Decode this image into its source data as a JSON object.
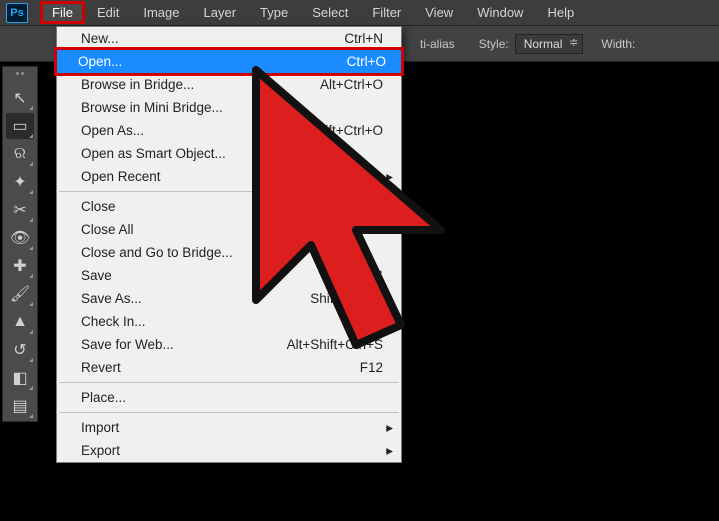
{
  "app": {
    "logo_text": "Ps"
  },
  "menubar": {
    "items": [
      "File",
      "Edit",
      "Image",
      "Layer",
      "Type",
      "Select",
      "Filter",
      "View",
      "Window",
      "Help"
    ]
  },
  "optionbar": {
    "antialias_label": "ti-alias",
    "style_label": "Style:",
    "style_value": "Normal",
    "width_label": "Width:"
  },
  "toolbox": {
    "tools": [
      {
        "name": "move-tool",
        "glyph": "↖"
      },
      {
        "name": "rect-marquee-tool",
        "glyph": "▭",
        "active": true
      },
      {
        "name": "lasso-tool",
        "glyph": "ର"
      },
      {
        "name": "magic-wand-tool",
        "glyph": "✦"
      },
      {
        "name": "crop-tool",
        "glyph": "✂"
      },
      {
        "name": "eyedropper-tool",
        "glyph": "👁"
      },
      {
        "name": "healing-brush-tool",
        "glyph": "✚"
      },
      {
        "name": "brush-tool",
        "glyph": "🖌"
      },
      {
        "name": "clone-stamp-tool",
        "glyph": "▲"
      },
      {
        "name": "history-brush-tool",
        "glyph": "↺"
      },
      {
        "name": "eraser-tool",
        "glyph": "◧"
      },
      {
        "name": "gradient-tool",
        "glyph": "▤"
      }
    ]
  },
  "file_menu": {
    "items": [
      {
        "label": "New...",
        "shortcut": "Ctrl+N"
      },
      {
        "label": "Open...",
        "shortcut": "Ctrl+O",
        "highlighted": true
      },
      {
        "label": "Browse in Bridge...",
        "shortcut": "Alt+Ctrl+O"
      },
      {
        "label": "Browse in Mini Bridge..."
      },
      {
        "label": "Open As...",
        "shortcut": "Alt+Shift+Ctrl+O"
      },
      {
        "label": "Open as Smart Object..."
      },
      {
        "label": "Open Recent",
        "submenu": true
      },
      {
        "sep": true
      },
      {
        "label": "Close"
      },
      {
        "label": "Close All"
      },
      {
        "label": "Close and Go to Bridge..."
      },
      {
        "label": "Save",
        "shortcut": "Ctrl+S"
      },
      {
        "label": "Save As...",
        "shortcut": "Shift+Ctrl+S"
      },
      {
        "label": "Check In..."
      },
      {
        "label": "Save for Web...",
        "shortcut": "Alt+Shift+Ctrl+S"
      },
      {
        "label": "Revert",
        "shortcut": "F12"
      },
      {
        "sep": true
      },
      {
        "label": "Place..."
      },
      {
        "sep": true
      },
      {
        "label": "Import",
        "submenu": true
      },
      {
        "label": "Export",
        "submenu": true
      }
    ]
  }
}
